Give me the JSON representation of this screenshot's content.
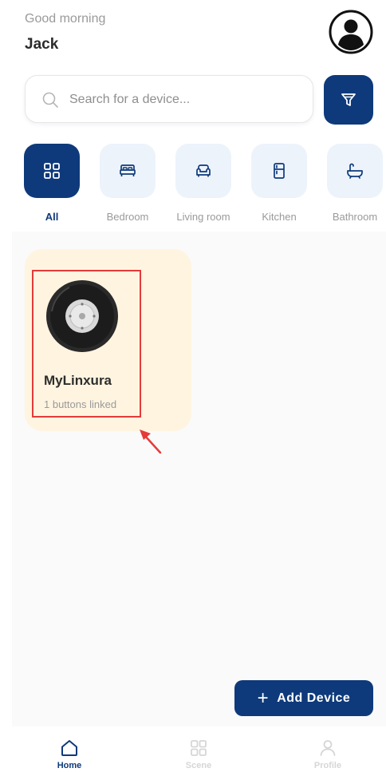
{
  "header": {
    "greeting": "Good morning",
    "username": "Jack"
  },
  "search": {
    "placeholder": "Search for a device..."
  },
  "categories": [
    {
      "label": "All",
      "icon": "grid-icon",
      "active": true
    },
    {
      "label": "Bedroom",
      "icon": "bed-icon",
      "active": false
    },
    {
      "label": "Living room",
      "icon": "sofa-icon",
      "active": false
    },
    {
      "label": "Kitchen",
      "icon": "fridge-icon",
      "active": false
    },
    {
      "label": "Bathroom",
      "icon": "bathtub-icon",
      "active": false
    }
  ],
  "devices": [
    {
      "name": "MyLinxura",
      "subtitle": "1 buttons linked"
    }
  ],
  "add_device": {
    "label": "Add Device"
  },
  "nav": {
    "home": "Home",
    "scene": "Scene",
    "profile": "Profile"
  },
  "colors": {
    "primary": "#0e3a7b",
    "category_bg": "#edf3fb",
    "card_bg": "#fff4e0",
    "highlight": "#e63a3a"
  }
}
